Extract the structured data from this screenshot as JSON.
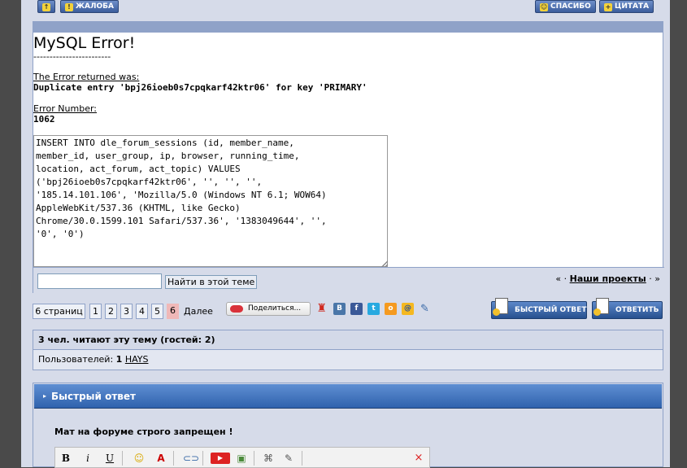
{
  "post_toolbar": {
    "up_label": "",
    "complaint_label": "ЖАЛОБА",
    "thanks_label": "СПАСИБО",
    "quote_label": "ЦИТАТА"
  },
  "error": {
    "title": "MySQL Error!",
    "divider": "------------------------",
    "returned_label": "The Error returned was:",
    "returned_value": "Duplicate entry 'bpj26ioeb0s7cpqkarf42ktr06' for key 'PRIMARY'",
    "number_label": "Error Number:",
    "number_value": "1062",
    "query": "INSERT INTO dle_forum_sessions (id, member_name,\nmember_id, user_group, ip, browser, running_time,\nlocation, act_forum, act_topic) VALUES\n('bpj26ioeb0s7cpqkarf42ktr06', '', '', '',\n'185.14.101.106', 'Mozilla/5.0 (Windows NT 6.1; WOW64)\nAppleWebKit/537.36 (KHTML, like Gecko)\nChrome/30.0.1599.101 Safari/537.36', '1383049644', '',\n'0', '0')"
  },
  "search": {
    "value": "",
    "button_label": "Найти в этой теме"
  },
  "nav": {
    "prev": "«",
    "sep1": "·",
    "projects": "Наши проекты",
    "sep2": "·",
    "next": "»"
  },
  "pager": {
    "pages_label": "6 страниц",
    "pages": [
      "1",
      "2",
      "3",
      "4",
      "5",
      "6"
    ],
    "current": "6",
    "next_label": "Далее"
  },
  "share": {
    "label": "Поделиться..."
  },
  "actions": {
    "quick_reply_label": "БЫСТРЫЙ ОТВЕТ",
    "reply_label": "ОТВЕТИТЬ"
  },
  "readers": {
    "title": "3 чел. читают эту тему (гостей: 2)",
    "users_label": "Пользователей:",
    "users_count": "1",
    "user_name": "HAYS"
  },
  "quick_reply": {
    "title": "Быстрый ответ",
    "note": "Мат на форуме строго запрещен !"
  },
  "colors": {
    "accent_blue": "#2f62ad",
    "current_page": "#f0b8b8",
    "panel_bg": "#d6dbe9"
  }
}
